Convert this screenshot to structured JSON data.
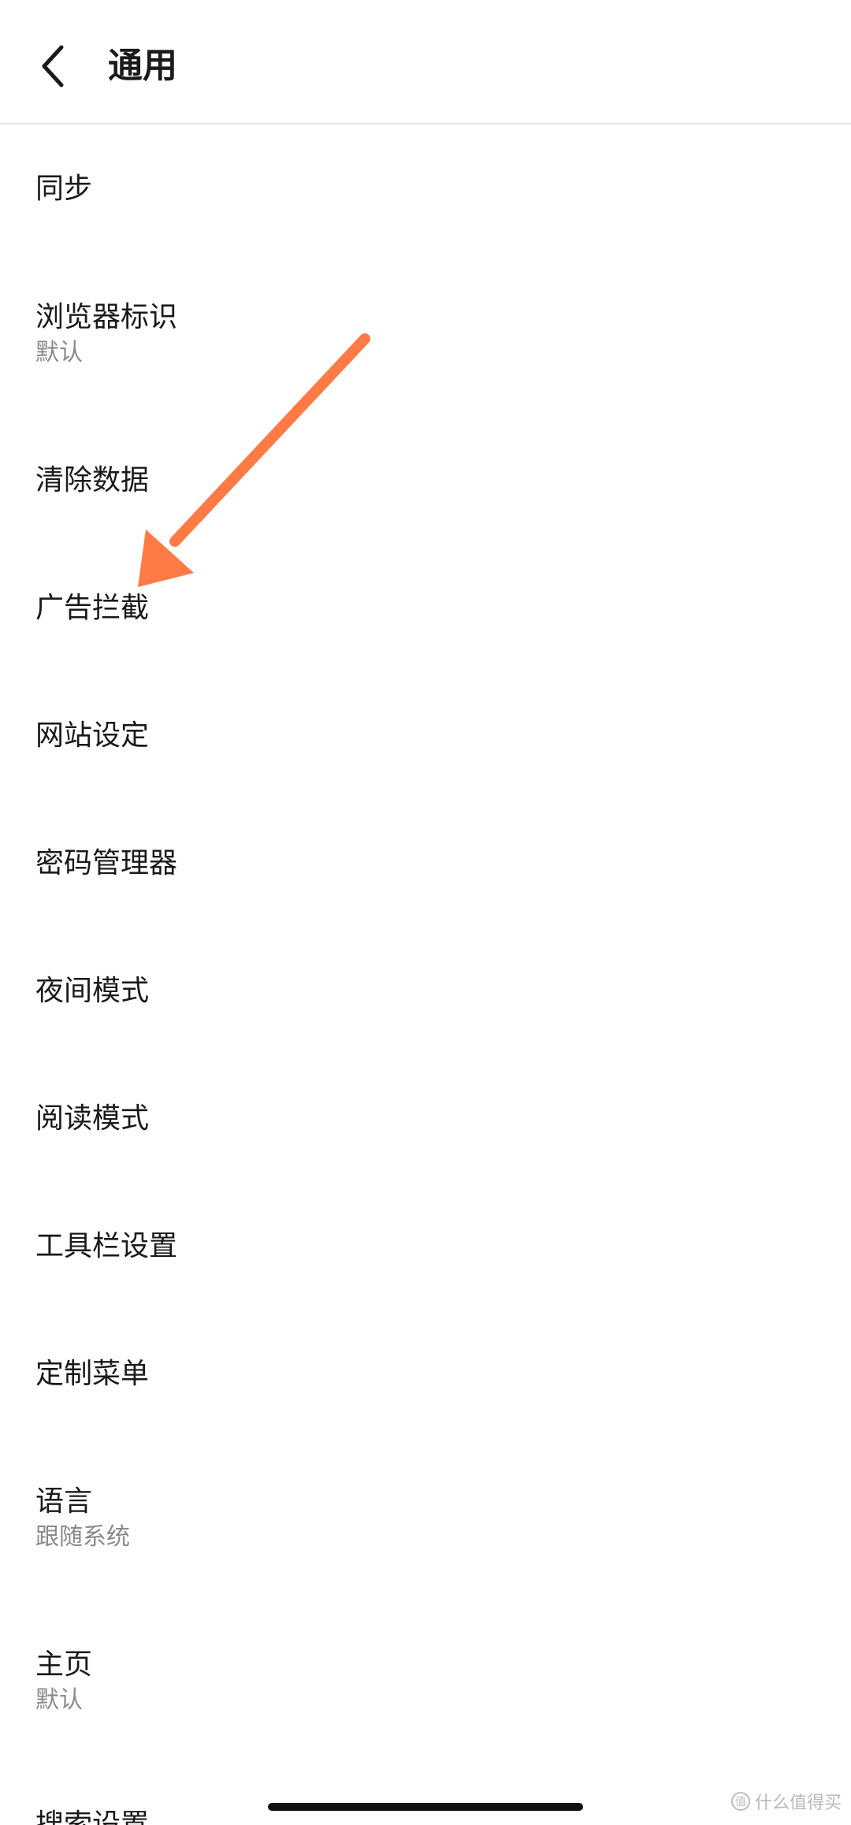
{
  "header": {
    "title": "通用",
    "back_icon": "chevron-left-icon"
  },
  "items": [
    {
      "key": "sync",
      "label": "同步",
      "sub": ""
    },
    {
      "key": "browser-ua",
      "label": "浏览器标识",
      "sub": "默认"
    },
    {
      "key": "clear-data",
      "label": "清除数据",
      "sub": ""
    },
    {
      "key": "ad-block",
      "label": "广告拦截",
      "sub": ""
    },
    {
      "key": "site-settings",
      "label": "网站设定",
      "sub": ""
    },
    {
      "key": "password-manager",
      "label": "密码管理器",
      "sub": ""
    },
    {
      "key": "night-mode",
      "label": "夜间模式",
      "sub": ""
    },
    {
      "key": "reading-mode",
      "label": "阅读模式",
      "sub": ""
    },
    {
      "key": "toolbar-settings",
      "label": "工具栏设置",
      "sub": ""
    },
    {
      "key": "custom-menu",
      "label": "定制菜单",
      "sub": ""
    },
    {
      "key": "language",
      "label": "语言",
      "sub": "跟随系统"
    },
    {
      "key": "homepage",
      "label": "主页",
      "sub": "默认"
    },
    {
      "key": "search-settings",
      "label": "搜索设置",
      "sub": ""
    }
  ],
  "annotation": {
    "arrow_color": "#ff7a45"
  },
  "watermark": {
    "icon": "zhi-icon",
    "text": "什么值得买"
  }
}
